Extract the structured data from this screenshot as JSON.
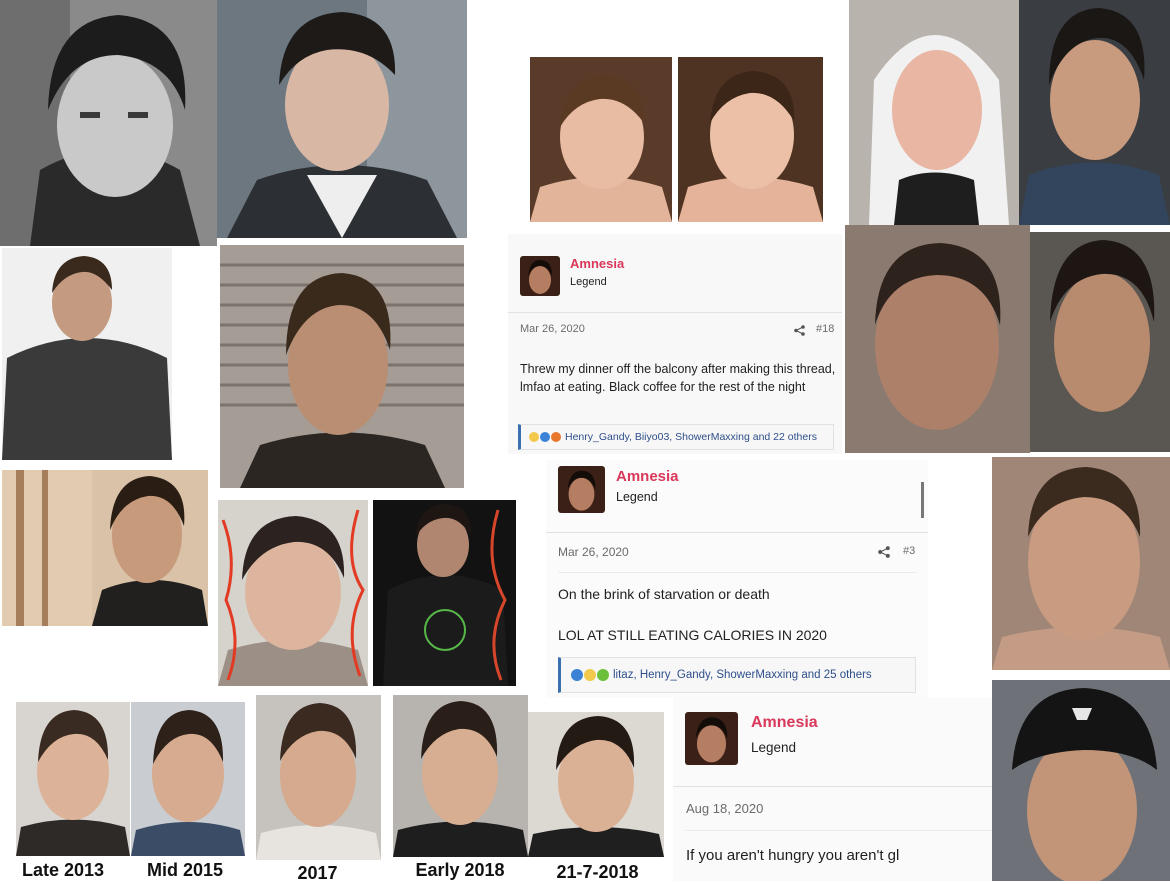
{
  "posts": [
    {
      "username": "Amnesia",
      "role": "Legend",
      "date": "Mar 26, 2020",
      "post_number": "#18",
      "body": "Threw my dinner off the balcony after making this thread, lmfao at eating. Black coffee for the rest of the night",
      "reactions_text": "Henry_Gandy, Biiyo03, ShowerMaxxing and 22 others"
    },
    {
      "username": "Amnesia",
      "role": "Legend",
      "date": "Mar 26, 2020",
      "post_number": "#3",
      "body_line1": "On the brink of starvation or death",
      "body_line2": "LOL AT STILL EATING CALORIES IN 2020",
      "reactions_text": "litaz, Henry_Gandy, ShowerMaxxing and 25 others"
    },
    {
      "username": "Amnesia",
      "role": "Legend",
      "date": "Aug 18, 2020",
      "body": "If you aren't hungry you aren't gl"
    }
  ],
  "timeline_captions": [
    "Late 2013",
    "Mid 2015",
    "2017",
    "Early 2018",
    "21-7-2018"
  ],
  "photos": [
    "portrait-bw-young-man",
    "portrait-man-undercut-suit",
    "portrait-shirtless-young-man-1",
    "portrait-shirtless-young-man-2",
    "portrait-man-white-hoodie",
    "portrait-man-car-selfie",
    "portrait-man-tshirt",
    "portrait-man-suit-window",
    "portrait-man-suit-profile",
    "portrait-young-man-selfie-doodles",
    "portrait-young-man-dark-hoodie",
    "portrait-man-close-selfie",
    "portrait-man-stubble-selfie",
    "portrait-man-short-hair",
    "portrait-man-cap"
  ]
}
